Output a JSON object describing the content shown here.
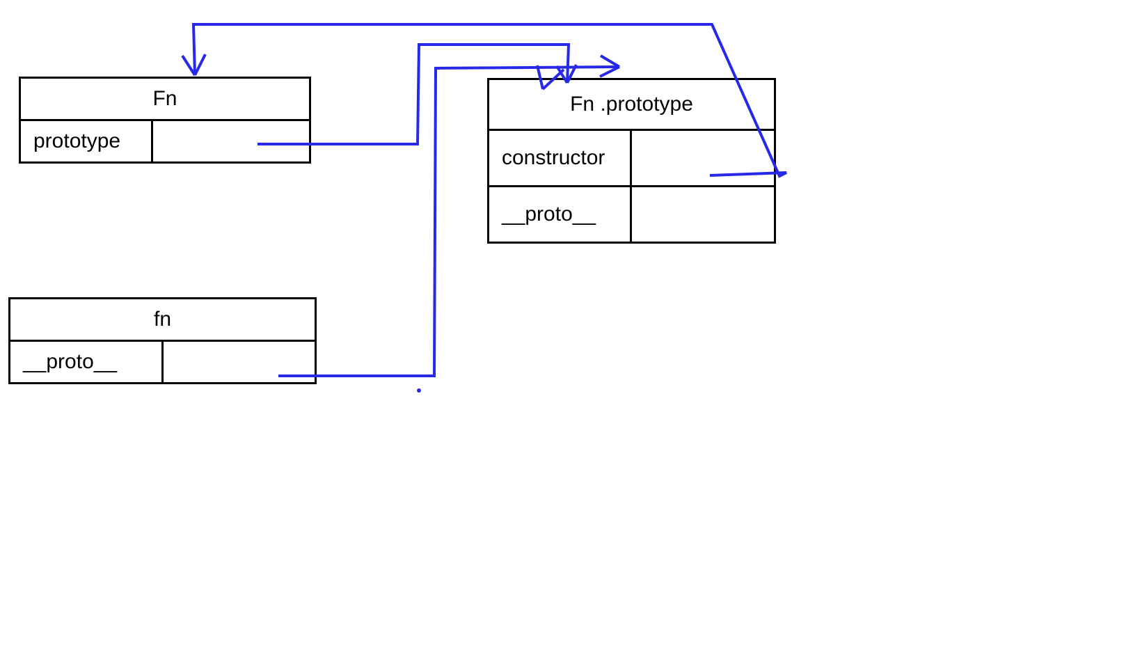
{
  "boxes": {
    "fn_upper": {
      "title": "Fn",
      "rows": [
        {
          "label": "prototype"
        }
      ]
    },
    "fn_prototype": {
      "title": "Fn .prototype",
      "rows": [
        {
          "label": "constructor"
        },
        {
          "label": "__proto__"
        }
      ]
    },
    "fn_lower": {
      "title": "fn",
      "rows": [
        {
          "label": "__proto__"
        }
      ]
    }
  },
  "arrows": [
    {
      "from": "Fn.prototype",
      "to": "Fn.prototype object"
    },
    {
      "from": "fn.__proto__",
      "to": "Fn.prototype object"
    },
    {
      "from": "Fn.prototype.constructor",
      "to": "Fn"
    }
  ],
  "colors": {
    "arrow": "#2828e8",
    "border": "#000000"
  }
}
